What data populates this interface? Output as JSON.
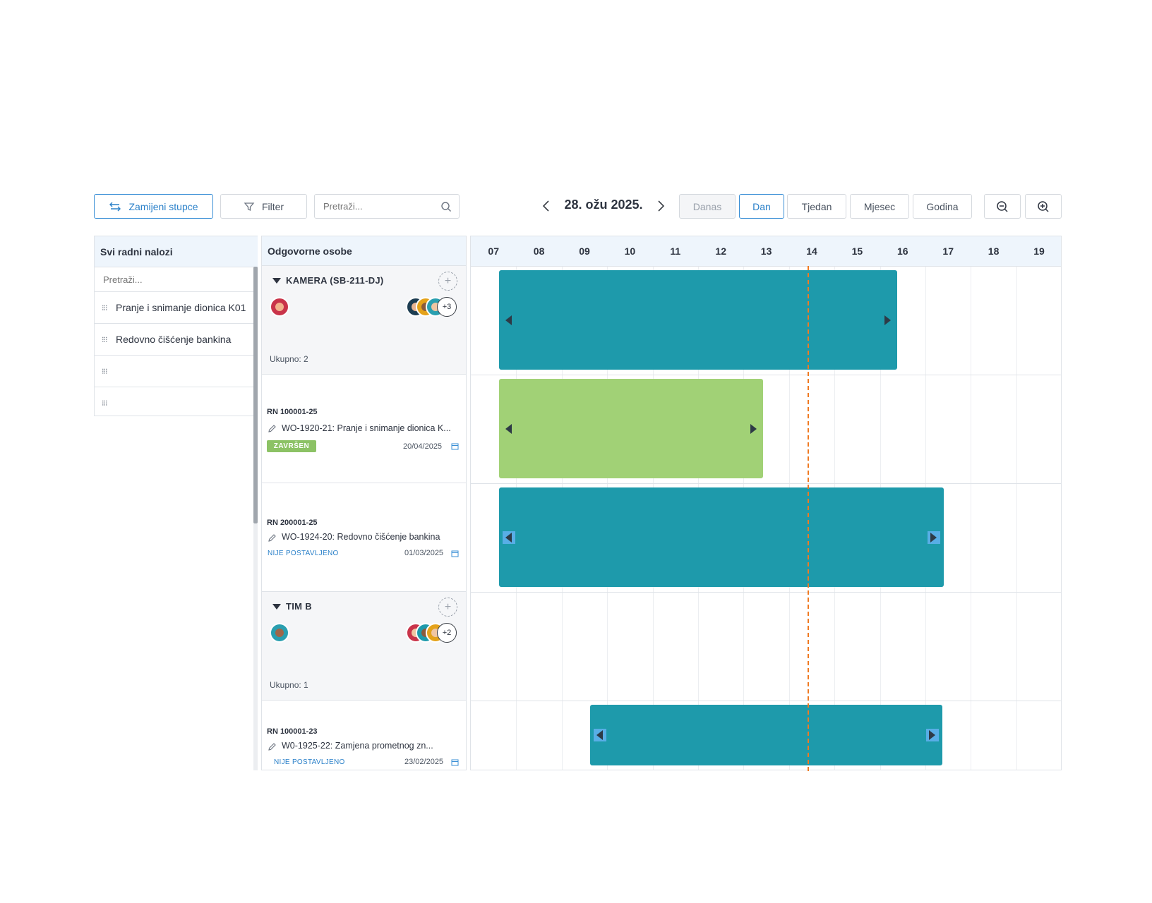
{
  "toolbar": {
    "swap_label": "Zamijeni stupce",
    "filter_label": "Filter",
    "search_placeholder": "Pretraži...",
    "date": "28. ožu 2025.",
    "today_label": "Danas",
    "views": [
      "Dan",
      "Tjedan",
      "Mjesec",
      "Godina"
    ],
    "active_view": "Dan"
  },
  "left_panel": {
    "title": "Svi radni nalozi",
    "search_placeholder": "Pretraži...",
    "items": [
      "Pranje i snimanje dionica K01",
      "Redovno čišćenje bankina",
      "",
      ""
    ]
  },
  "resources": {
    "title": "Odgovorne osobe",
    "groups": [
      {
        "name": "KAMERA (SB-211-DJ)",
        "total": "Ukupno: 2",
        "extra_count": "+3",
        "orders": [
          {
            "rn": "RN 100001-25",
            "wo": "WO-1920-21: Pranje i snimanje dionica K...",
            "status": "ZAVRŠEN",
            "date": "20/04/2025"
          },
          {
            "rn": "RN 200001-25",
            "wo": "WO-1924-20: Redovno čišćenje bankina",
            "status": "NIJE POSTAVLJENO",
            "date": "01/03/2025"
          }
        ]
      },
      {
        "name": "TIM B",
        "total": "Ukupno: 1",
        "extra_count": "+2",
        "orders": [
          {
            "rn": "RN 100001-23",
            "wo": "W0-1925-22: Zamjena prometnog zn...",
            "status": "NIJE POSTAVLJENO",
            "date": "23/02/2025"
          }
        ]
      }
    ]
  },
  "timeline": {
    "hours": [
      "07",
      "08",
      "09",
      "10",
      "11",
      "12",
      "13",
      "14",
      "15",
      "16",
      "17",
      "18",
      "19"
    ],
    "now_hour": 14.4,
    "bars": [
      {
        "row": 0,
        "start": 7.62,
        "end": 16.38,
        "color": "#1e9aab"
      },
      {
        "row": 1,
        "start": 7.62,
        "end": 13.43,
        "color": "#a1d176"
      },
      {
        "row": 2,
        "start": 7.62,
        "end": 17.4,
        "color": "#1e9aab"
      },
      {
        "row": 4,
        "start": 9.62,
        "end": 17.37,
        "color": "#1e9aab"
      }
    ]
  },
  "colors": {
    "accent": "#2a80c9",
    "now_line": "#f07a22",
    "bar_teal": "#1e9aab",
    "bar_green": "#a1d176"
  }
}
